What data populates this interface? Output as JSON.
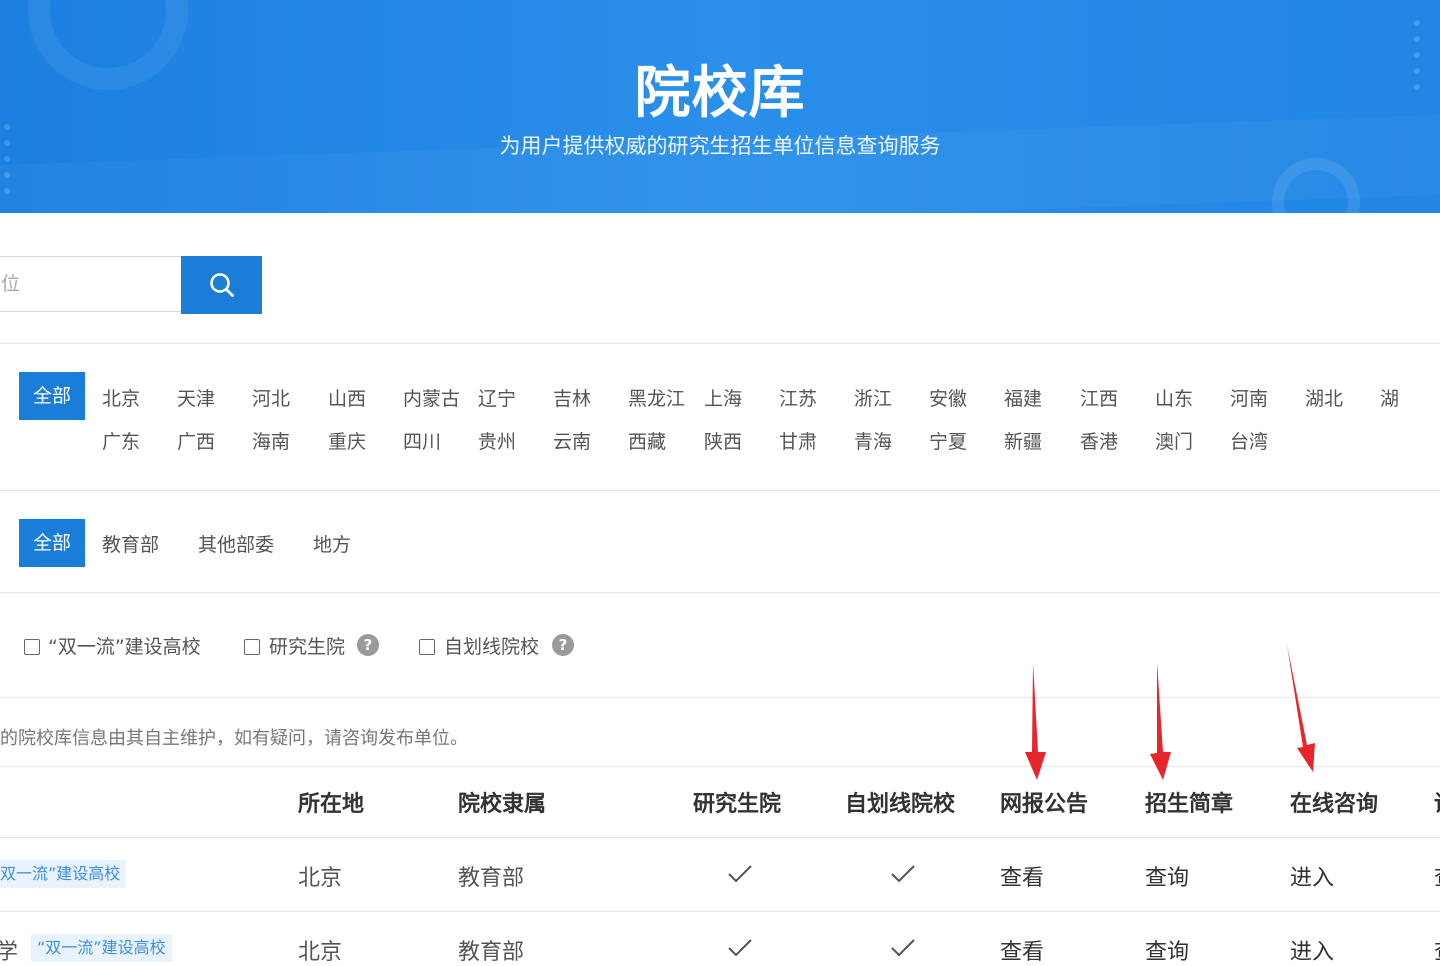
{
  "banner": {
    "title": "院校库",
    "subtitle": "为用户提供权威的研究生招生单位信息查询服务"
  },
  "search": {
    "placeholder": "位",
    "icon": "search-icon"
  },
  "colors": {
    "accent": "#1a7ed8",
    "banner": "#2a8fea",
    "arrow": "#e8252b",
    "tag_bg": "#e9f3fd",
    "tag_text": "#3b8ee0"
  },
  "regions": {
    "all_label": "全部",
    "row1": [
      "北京",
      "天津",
      "河北",
      "山西",
      "内蒙古",
      "辽宁",
      "吉林",
      "黑龙江",
      "上海",
      "江苏",
      "浙江",
      "安徽",
      "福建",
      "江西",
      "山东",
      "河南",
      "湖北",
      "湖"
    ],
    "row2": [
      "广东",
      "广西",
      "海南",
      "重庆",
      "四川",
      "贵州",
      "云南",
      "西藏",
      "陕西",
      "甘肃",
      "青海",
      "宁夏",
      "新疆",
      "香港",
      "澳门",
      "台湾"
    ]
  },
  "affiliation": {
    "all_label": "全部",
    "options": [
      "教育部",
      "其他部委",
      "地方"
    ]
  },
  "features": [
    {
      "label": "“双一流”建设高校",
      "help": false
    },
    {
      "label": "研究生院",
      "help": true
    },
    {
      "label": "自划线院校",
      "help": true
    }
  ],
  "help_glyph": "?",
  "note": "的院校库信息由其自主维护，如有疑问，请咨询发布单位。",
  "table": {
    "headers": [
      "所在地",
      "院校隶属",
      "研究生院",
      "自划线院校",
      "网报公告",
      "招生简章",
      "在线咨询",
      "调"
    ],
    "rows": [
      {
        "name": "",
        "tag": "双一流”建设高校",
        "location": "北京",
        "affiliation": "教育部",
        "grad_school": true,
        "self_line": true,
        "notice": "查看",
        "brochure": "查询",
        "consult": "进入",
        "more": "查"
      },
      {
        "name": "学",
        "tag": "“双一流”建设高校",
        "location": "北京",
        "affiliation": "教育部",
        "grad_school": true,
        "self_line": true,
        "notice": "查看",
        "brochure": "查询",
        "consult": "进入",
        "more": "查"
      }
    ]
  }
}
